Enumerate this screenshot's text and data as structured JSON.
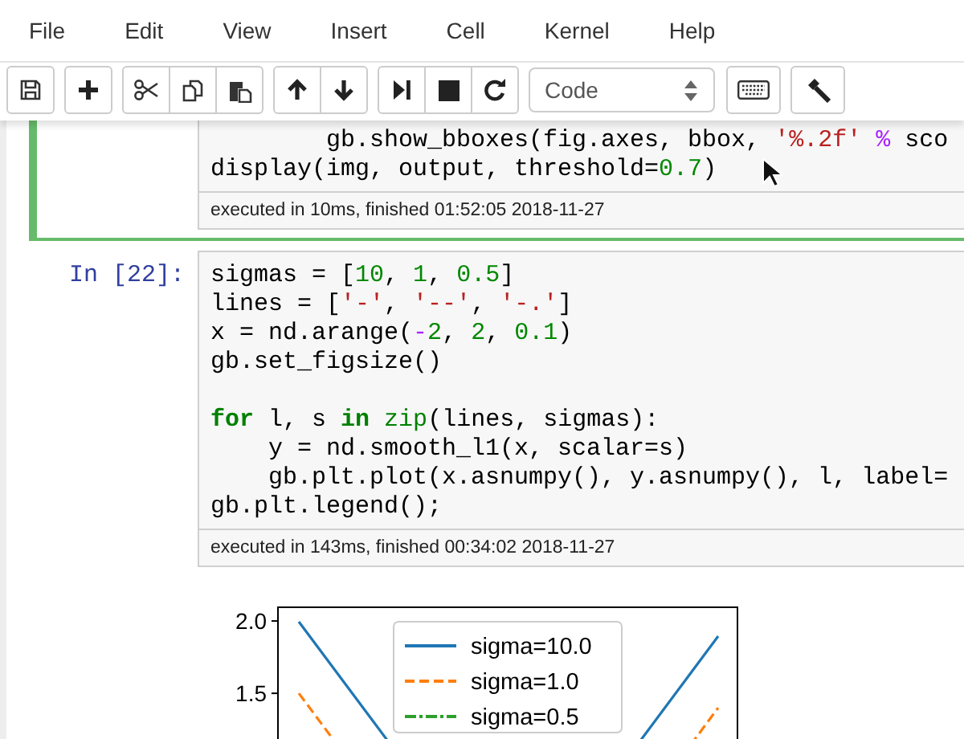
{
  "menu": [
    "File",
    "Edit",
    "View",
    "Insert",
    "Cell",
    "Kernel",
    "Help"
  ],
  "cell_type_select": {
    "value": "Code"
  },
  "cells": [
    {
      "selected": true,
      "lines": [
        {
          "tokens": [
            {
              "text": "        gb.show_bboxes(fig.axes, bbox, ",
              "kind": "plain"
            },
            {
              "text": "'%.2f' ",
              "kind": "string"
            },
            {
              "text": "%",
              "kind": "operator"
            },
            {
              "text": " sco",
              "kind": "plain"
            }
          ]
        },
        {
          "tokens": [
            {
              "text": "display(img, output, threshold=",
              "kind": "plain"
            },
            {
              "text": "0.7",
              "kind": "number"
            },
            {
              "text": ")",
              "kind": "plain"
            }
          ]
        }
      ],
      "execution": "executed in 10ms, finished 01:52:05 2018-11-27"
    },
    {
      "selected": false,
      "prompt": "In [22]:",
      "lines": [
        {
          "tokens": [
            {
              "text": "sigmas = [",
              "kind": "plain"
            },
            {
              "text": "10",
              "kind": "number"
            },
            {
              "text": ", ",
              "kind": "plain"
            },
            {
              "text": "1",
              "kind": "number"
            },
            {
              "text": ", ",
              "kind": "plain"
            },
            {
              "text": "0.5",
              "kind": "number"
            },
            {
              "text": "]",
              "kind": "plain"
            }
          ]
        },
        {
          "tokens": [
            {
              "text": "lines = [",
              "kind": "plain"
            },
            {
              "text": "'-'",
              "kind": "string"
            },
            {
              "text": ", ",
              "kind": "plain"
            },
            {
              "text": "'--'",
              "kind": "string"
            },
            {
              "text": ", ",
              "kind": "plain"
            },
            {
              "text": "'-.'",
              "kind": "string"
            },
            {
              "text": "]",
              "kind": "plain"
            }
          ]
        },
        {
          "tokens": [
            {
              "text": "x = nd.arange(",
              "kind": "plain"
            },
            {
              "text": "-",
              "kind": "operator"
            },
            {
              "text": "2",
              "kind": "number"
            },
            {
              "text": ", ",
              "kind": "plain"
            },
            {
              "text": "2",
              "kind": "number"
            },
            {
              "text": ", ",
              "kind": "plain"
            },
            {
              "text": "0.1",
              "kind": "number"
            },
            {
              "text": ")",
              "kind": "plain"
            }
          ]
        },
        {
          "tokens": [
            {
              "text": "gb.set_figsize()",
              "kind": "plain"
            }
          ]
        },
        {
          "gap_before": true,
          "tokens": [
            {
              "text": "for",
              "kind": "keyword"
            },
            {
              "text": " l, s ",
              "kind": "plain"
            },
            {
              "text": "in ",
              "kind": "keyword"
            },
            {
              "text": "zip",
              "kind": "builtin"
            },
            {
              "text": "(lines, sigmas):",
              "kind": "plain"
            }
          ]
        },
        {
          "tokens": [
            {
              "text": "    y = nd.smooth_l1(x, scalar=s)",
              "kind": "plain"
            }
          ]
        },
        {
          "tokens": [
            {
              "text": "    gb.plt.plot(x.asnumpy(), y.asnumpy(), l, label=",
              "kind": "plain"
            }
          ]
        },
        {
          "tokens": [
            {
              "text": "gb.plt.legend();",
              "kind": "plain"
            }
          ]
        }
      ],
      "execution": "executed in 143ms, finished 00:34:02 2018-11-27"
    }
  ],
  "output": {
    "plot": {
      "y_tick_labels": [
        "2.0",
        "1.5"
      ],
      "legend": [
        {
          "label": "sigma=10.0",
          "color": "#1f77b4",
          "kind": "solid"
        },
        {
          "label": "sigma=1.0",
          "color": "#ff7f0e",
          "kind": "dashed"
        },
        {
          "label": "sigma=0.5",
          "color": "#2ca02c",
          "kind": "dashdot"
        }
      ]
    }
  }
}
